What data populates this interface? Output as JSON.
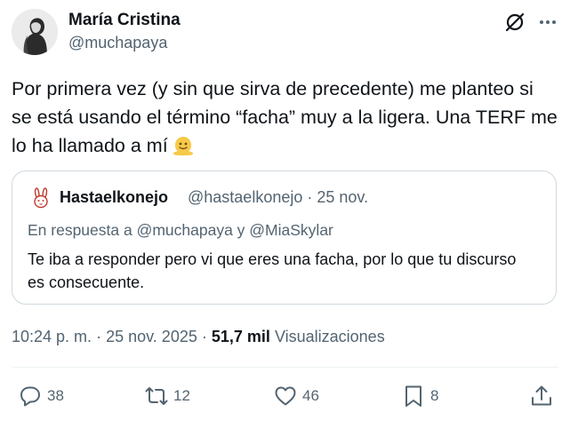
{
  "author": {
    "name": "María Cristina",
    "handle": "@muchapaya"
  },
  "tweet": {
    "text": "Por primera vez (y sin que sirva de precedente) me planteo si se está usando el término “facha” muy a la ligera. Una TERF me lo ha llamado a mí",
    "emoji_icon": "melting-face-emoji"
  },
  "quoted": {
    "name": "Hastaelkonejo",
    "handle": "@hastaelkonejo",
    "separator": "·",
    "date": "25 nov.",
    "reply_to": "En respuesta a @muchapaya y @MiaSkylar",
    "text": "Te iba a responder pero vi que eres una facha, por lo que tu discurso es consecuente."
  },
  "meta": {
    "time": "10:24 p. m.",
    "separator": "·",
    "date": "25 nov. 2025",
    "views_count": "51,7 mil",
    "views_label": "Visualizaciones"
  },
  "actions": {
    "replies": "38",
    "reposts": "12",
    "likes": "46",
    "bookmarks": "8"
  },
  "colors": {
    "text_primary": "#0f1419",
    "text_secondary": "#536471",
    "border": "#cfd9de",
    "divider": "#eff3f4",
    "emoji": "#f7c948"
  }
}
